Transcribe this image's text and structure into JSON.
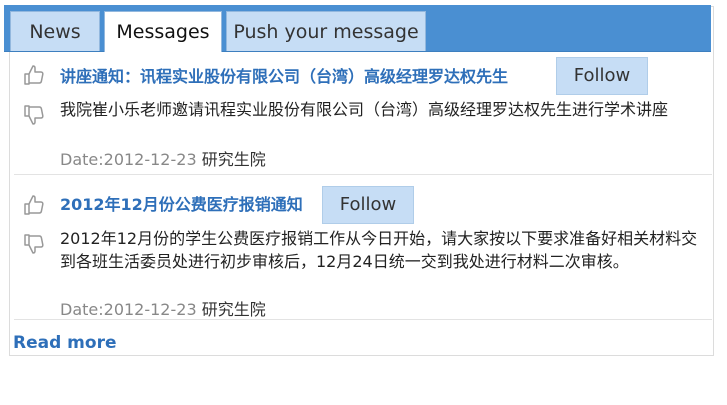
{
  "tabs": {
    "news": "News",
    "messages": "Messages",
    "push": "Push your message"
  },
  "messages": [
    {
      "title": "讲座通知：讯程实业股份有限公司（台湾）高级经理罗达权先生",
      "follow": "Follow",
      "body": "我院崔小乐老师邀请讯程实业股份有限公司（台湾）高级经理罗达权先生进行学术讲座",
      "date": "Date:2012-12-23",
      "source": "研究生院"
    },
    {
      "title": "2012年12月份公费医疗报销通知",
      "follow": "Follow",
      "body": "2012年12月份的学生公费医疗报销工作从今日开始，请大家按以下要求准备好相关材料交到各班生活委员处进行初步审核后，12月24日统一交到我处进行材料二次审核。",
      "date": "Date:2012-12-23",
      "source": "研究生院"
    }
  ],
  "read_more": "Read more",
  "colors": {
    "tabbar": "#4a8fd2",
    "tab": "#c6ddf5",
    "link": "#2e6fb9",
    "muted": "#888888"
  },
  "icons": [
    "thumbs-up-icon",
    "thumbs-down-icon"
  ]
}
